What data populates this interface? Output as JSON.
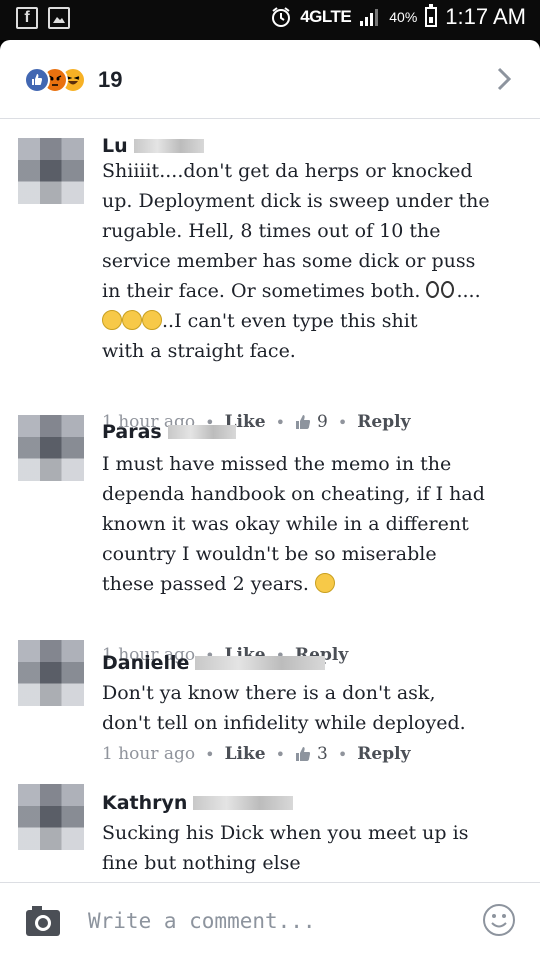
{
  "status_bar": {
    "network": "4GLTE",
    "battery_percent": "40%",
    "time": "1:17 AM"
  },
  "reactions": {
    "icons": [
      "like-icon",
      "angry-icon",
      "haha-icon"
    ],
    "count": "19"
  },
  "comments": [
    {
      "name": "Lu",
      "text_lines": [
        "Shiiiit....don't get da herps or knocked",
        "up. Deployment dick is sweep under the",
        "rugable. Hell, 8 times out of 10 the",
        "service member has some dick or puss",
        "in their face. Or sometimes both.",
        "..I can't even type this shit",
        "with a straight face."
      ],
      "eyes_suffix": "....",
      "time": "1 hour ago",
      "like_label": "Like",
      "likes": "9",
      "reply_label": "Reply"
    },
    {
      "name": "Paras",
      "text_lines": [
        "I must have missed the memo in the",
        "dependa handbook on cheating, if I had",
        "known it was okay while in a different",
        "country I wouldn't be so miserable",
        "these passed 2 years."
      ],
      "time": "1 hour ago",
      "like_label": "Like",
      "reply_label": "Reply"
    },
    {
      "name": "Danielle",
      "text_lines": [
        "Don't ya know there is a don't ask,",
        "don't tell on infidelity while deployed."
      ],
      "time": "1 hour ago",
      "like_label": "Like",
      "likes": "3",
      "reply_label": "Reply"
    },
    {
      "name": "Kathryn",
      "text_lines": [
        "Sucking his Dick when you meet up is",
        "fine but nothing else"
      ]
    }
  ],
  "composer": {
    "placeholder": "Write a comment..."
  },
  "colors": {
    "accent": "#4267b2",
    "text": "#1d2129",
    "meta": "#90949c"
  }
}
